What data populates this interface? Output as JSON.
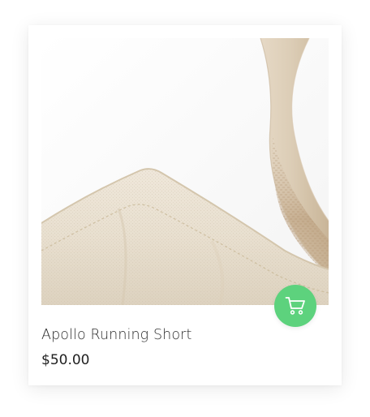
{
  "product": {
    "title": "Apollo Running Short",
    "price": "$50.00",
    "image_subject": "canvas-tote-bag-closeup"
  },
  "cart_button": {
    "icon": "shopping-cart-icon",
    "color": "#5dd27d"
  },
  "colors": {
    "card_background": "#ffffff",
    "title_text": "#2b2b2b",
    "price_text": "#1f1f1f"
  }
}
